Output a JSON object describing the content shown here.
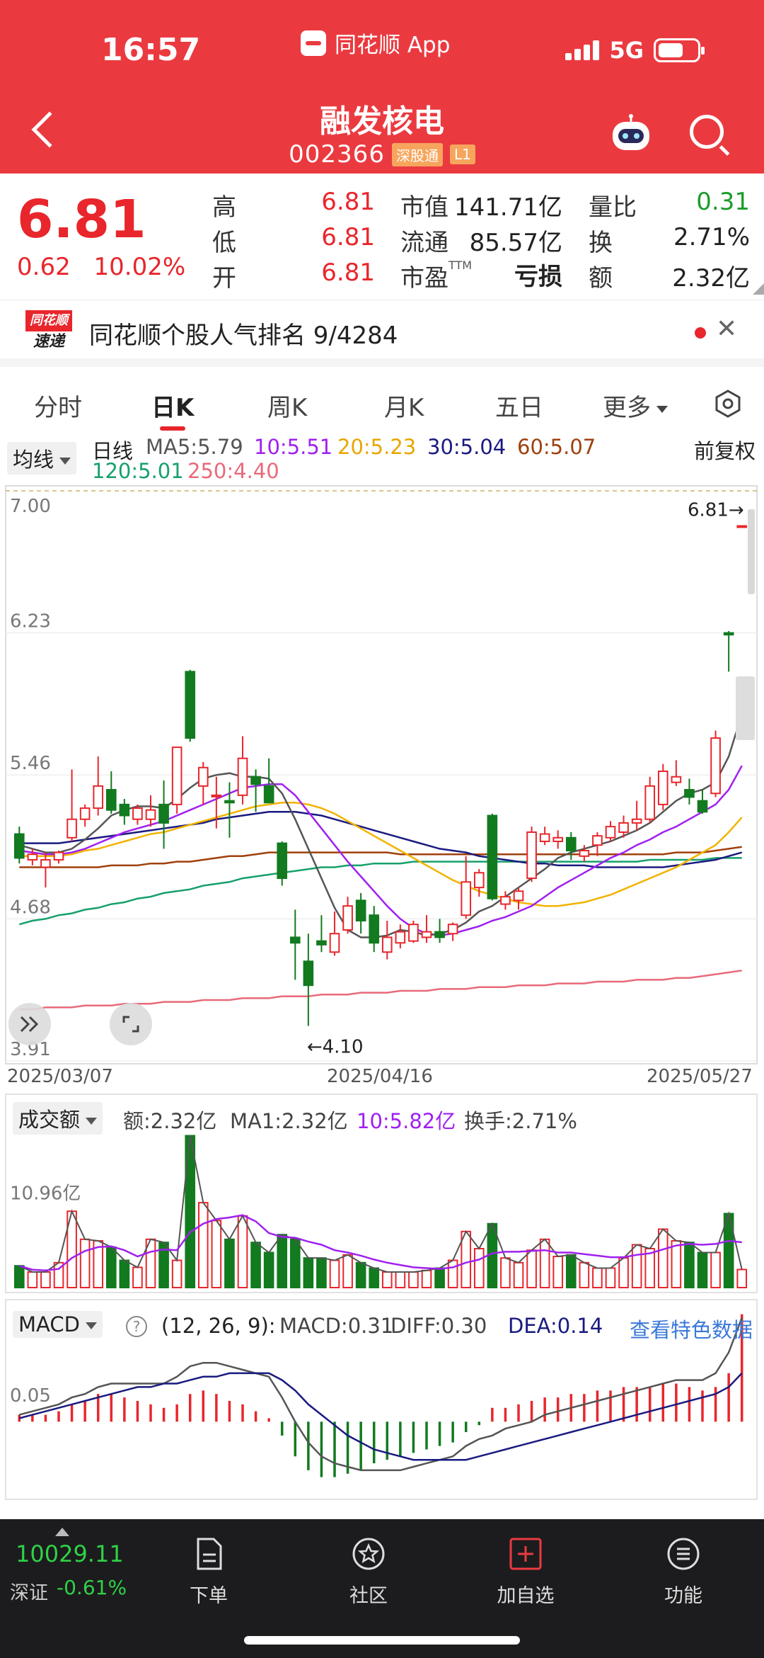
{
  "status": {
    "time": "16:57",
    "app_name": "同花顺 App",
    "network": "5G"
  },
  "header": {
    "stock_name": "融发核电",
    "stock_code": "002366",
    "tag_connect": "深股通",
    "tag_level": "L1"
  },
  "quote": {
    "price": "6.81",
    "change": "0.62",
    "change_pct": "10.02%",
    "high_label": "高",
    "high": "6.81",
    "low_label": "低",
    "low": "6.81",
    "open_label": "开",
    "open": "6.81",
    "mktcap_label": "市值",
    "mktcap": "141.71亿",
    "float_label": "流通",
    "float_cap": "85.57亿",
    "pe_label": "市盈",
    "pe_sup": "TTM",
    "pe": "亏损",
    "vol_ratio_label": "量比",
    "vol_ratio": "0.31",
    "turnover_label": "换",
    "turnover": "2.71%",
    "amount_label": "额",
    "amount": "2.32亿"
  },
  "banner": {
    "logo_top": "同花顺",
    "logo_bottom": "速递",
    "text": "同花顺个股人气排名 9/4284"
  },
  "tabs": [
    "分时",
    "日K",
    "周K",
    "月K",
    "五日",
    "更多"
  ],
  "legend": {
    "type_dropdown": "均线",
    "period": "日线",
    "ma5": "MA5:5.79",
    "ma10": "10:5.51",
    "ma20": "20:5.23",
    "ma30": "30:5.04",
    "ma60": "60:5.07",
    "ma120": "120:5.01",
    "ma250": "250:4.40",
    "adjust": "前复权"
  },
  "colors": {
    "up": "#e8262c",
    "down": "#127a1f",
    "ma5": "#555555",
    "ma10": "#a020f0",
    "ma20": "#f2b300",
    "ma30": "#1a1a80",
    "ma60": "#a0400c",
    "ma120": "#17a06c",
    "ma250": "#e86a7a"
  },
  "chart_data": [
    {
      "type": "candlestick",
      "y_ticks": [
        "7.00",
        "6.23",
        "5.46",
        "4.68",
        "3.91"
      ],
      "ylim": [
        3.91,
        7.0
      ],
      "x_labels": [
        "2025/03/07",
        "2025/04/16",
        "2025/05/27"
      ],
      "max_label": "6.81",
      "min_label": "4.10",
      "candles": [
        {
          "o": 5.14,
          "h": 5.18,
          "l": 4.98,
          "c": 5.01
        },
        {
          "o": 5.0,
          "h": 5.06,
          "l": 4.97,
          "c": 5.03
        },
        {
          "o": 4.96,
          "h": 5.04,
          "l": 4.85,
          "c": 5.0
        },
        {
          "o": 5.0,
          "h": 5.05,
          "l": 4.98,
          "c": 5.04
        },
        {
          "o": 5.12,
          "h": 5.49,
          "l": 5.1,
          "c": 5.22
        },
        {
          "o": 5.22,
          "h": 5.3,
          "l": 5.18,
          "c": 5.28
        },
        {
          "o": 5.28,
          "h": 5.56,
          "l": 5.24,
          "c": 5.4
        },
        {
          "o": 5.38,
          "h": 5.48,
          "l": 5.25,
          "c": 5.27
        },
        {
          "o": 5.3,
          "h": 5.33,
          "l": 5.19,
          "c": 5.24
        },
        {
          "o": 5.22,
          "h": 5.3,
          "l": 5.19,
          "c": 5.28
        },
        {
          "o": 5.22,
          "h": 5.35,
          "l": 5.18,
          "c": 5.27
        },
        {
          "o": 5.3,
          "h": 5.43,
          "l": 5.06,
          "c": 5.2
        },
        {
          "o": 5.3,
          "h": 5.6,
          "l": 5.25,
          "c": 5.61
        },
        {
          "o": 6.02,
          "h": 6.03,
          "l": 5.64,
          "c": 5.66
        },
        {
          "o": 5.4,
          "h": 5.53,
          "l": 5.3,
          "c": 5.5
        },
        {
          "o": 5.35,
          "h": 5.45,
          "l": 5.17,
          "c": 5.35
        },
        {
          "o": 5.32,
          "h": 5.42,
          "l": 5.12,
          "c": 5.31
        },
        {
          "o": 5.35,
          "h": 5.67,
          "l": 5.3,
          "c": 5.55
        },
        {
          "o": 5.45,
          "h": 5.49,
          "l": 5.26,
          "c": 5.41
        },
        {
          "o": 5.4,
          "h": 5.55,
          "l": 5.33,
          "c": 5.31
        },
        {
          "o": 5.09,
          "h": 5.1,
          "l": 4.86,
          "c": 4.9
        },
        {
          "o": 4.58,
          "h": 4.73,
          "l": 4.35,
          "c": 4.55
        },
        {
          "o": 4.45,
          "h": 4.6,
          "l": 4.1,
          "c": 4.32
        },
        {
          "o": 4.56,
          "h": 4.7,
          "l": 4.5,
          "c": 4.54
        },
        {
          "o": 4.5,
          "h": 4.72,
          "l": 4.48,
          "c": 4.6
        },
        {
          "o": 4.62,
          "h": 4.8,
          "l": 4.6,
          "c": 4.75
        },
        {
          "o": 4.78,
          "h": 4.82,
          "l": 4.6,
          "c": 4.67
        },
        {
          "o": 4.7,
          "h": 4.75,
          "l": 4.5,
          "c": 4.55
        },
        {
          "o": 4.5,
          "h": 4.67,
          "l": 4.46,
          "c": 4.58
        },
        {
          "o": 4.55,
          "h": 4.65,
          "l": 4.52,
          "c": 4.61
        },
        {
          "o": 4.56,
          "h": 4.67,
          "l": 4.55,
          "c": 4.65
        },
        {
          "o": 4.58,
          "h": 4.7,
          "l": 4.55,
          "c": 4.61
        },
        {
          "o": 4.61,
          "h": 4.68,
          "l": 4.55,
          "c": 4.58
        },
        {
          "o": 4.6,
          "h": 4.66,
          "l": 4.56,
          "c": 4.65
        },
        {
          "o": 4.7,
          "h": 5.02,
          "l": 4.68,
          "c": 4.88
        },
        {
          "o": 4.85,
          "h": 4.95,
          "l": 4.8,
          "c": 4.93
        },
        {
          "o": 5.24,
          "h": 5.25,
          "l": 4.78,
          "c": 4.79
        },
        {
          "o": 4.76,
          "h": 4.83,
          "l": 4.73,
          "c": 4.8
        },
        {
          "o": 4.78,
          "h": 4.85,
          "l": 4.73,
          "c": 4.83
        },
        {
          "o": 4.9,
          "h": 5.18,
          "l": 4.88,
          "c": 5.15
        },
        {
          "o": 5.1,
          "h": 5.18,
          "l": 5.08,
          "c": 5.14
        },
        {
          "o": 5.1,
          "h": 5.16,
          "l": 5.06,
          "c": 5.12
        },
        {
          "o": 5.12,
          "h": 5.15,
          "l": 5.0,
          "c": 5.05
        },
        {
          "o": 5.02,
          "h": 5.08,
          "l": 4.99,
          "c": 5.05
        },
        {
          "o": 5.08,
          "h": 5.15,
          "l": 5.02,
          "c": 5.13
        },
        {
          "o": 5.12,
          "h": 5.21,
          "l": 5.1,
          "c": 5.18
        },
        {
          "o": 5.15,
          "h": 5.24,
          "l": 5.12,
          "c": 5.2
        },
        {
          "o": 5.2,
          "h": 5.32,
          "l": 5.16,
          "c": 5.22
        },
        {
          "o": 5.22,
          "h": 5.45,
          "l": 5.2,
          "c": 5.4
        },
        {
          "o": 5.3,
          "h": 5.52,
          "l": 5.27,
          "c": 5.48
        },
        {
          "o": 5.42,
          "h": 5.54,
          "l": 5.4,
          "c": 5.45
        },
        {
          "o": 5.38,
          "h": 5.44,
          "l": 5.3,
          "c": 5.34
        },
        {
          "o": 5.32,
          "h": 5.38,
          "l": 5.25,
          "c": 5.26
        },
        {
          "o": 5.36,
          "h": 5.7,
          "l": 5.34,
          "c": 5.66
        },
        {
          "o": 6.23,
          "h": 6.24,
          "l": 6.02,
          "c": 6.22
        },
        {
          "o": 6.81,
          "h": 6.81,
          "l": 6.81,
          "c": 6.81
        }
      ],
      "ma_series": {
        "ma5": [
          5.08,
          5.06,
          5.04,
          5.04,
          5.06,
          5.11,
          5.17,
          5.24,
          5.27,
          5.29,
          5.29,
          5.28,
          5.33,
          5.39,
          5.44,
          5.46,
          5.47,
          5.45,
          5.45,
          5.44,
          5.36,
          5.22,
          5.06,
          4.9,
          4.74,
          4.62,
          4.58,
          4.58,
          4.59,
          4.62,
          4.61,
          4.59,
          4.6,
          4.62,
          4.66,
          4.72,
          4.75,
          4.8,
          4.85,
          4.9,
          4.95,
          5.01,
          5.04,
          5.06,
          5.08,
          5.1,
          5.13,
          5.16,
          5.2,
          5.26,
          5.32,
          5.36,
          5.38,
          5.42,
          5.56,
          5.79
        ],
        "ma10": [
          5.05,
          5.04,
          5.03,
          5.03,
          5.04,
          5.06,
          5.09,
          5.12,
          5.15,
          5.17,
          5.19,
          5.21,
          5.24,
          5.27,
          5.3,
          5.33,
          5.36,
          5.39,
          5.4,
          5.41,
          5.41,
          5.35,
          5.26,
          5.17,
          5.08,
          4.99,
          4.91,
          4.83,
          4.75,
          4.68,
          4.63,
          4.6,
          4.59,
          4.6,
          4.62,
          4.64,
          4.67,
          4.69,
          4.72,
          4.75,
          4.8,
          4.85,
          4.89,
          4.93,
          4.97,
          5.01,
          5.04,
          5.08,
          5.11,
          5.15,
          5.18,
          5.22,
          5.26,
          5.3,
          5.38,
          5.51
        ],
        "ma20": [
          5.02,
          5.02,
          5.02,
          5.02,
          5.03,
          5.05,
          5.06,
          5.08,
          5.1,
          5.12,
          5.14,
          5.15,
          5.17,
          5.19,
          5.21,
          5.23,
          5.25,
          5.27,
          5.29,
          5.3,
          5.31,
          5.31,
          5.3,
          5.28,
          5.25,
          5.21,
          5.17,
          5.13,
          5.09,
          5.05,
          5.01,
          4.97,
          4.93,
          4.89,
          4.86,
          4.83,
          4.81,
          4.79,
          4.77,
          4.76,
          4.75,
          4.75,
          4.76,
          4.77,
          4.79,
          4.81,
          4.84,
          4.87,
          4.9,
          4.93,
          4.96,
          5.0,
          5.04,
          5.08,
          5.15,
          5.23
        ],
        "ma30": [
          5.09,
          5.09,
          5.09,
          5.09,
          5.1,
          5.11,
          5.12,
          5.13,
          5.14,
          5.15,
          5.16,
          5.17,
          5.18,
          5.19,
          5.2,
          5.22,
          5.23,
          5.24,
          5.25,
          5.26,
          5.26,
          5.26,
          5.25,
          5.24,
          5.22,
          5.2,
          5.18,
          5.16,
          5.14,
          5.12,
          5.1,
          5.08,
          5.06,
          5.05,
          5.04,
          5.02,
          5.01,
          5.0,
          4.99,
          4.98,
          4.98,
          4.97,
          4.97,
          4.97,
          4.96,
          4.96,
          4.96,
          4.96,
          4.96,
          4.96,
          4.97,
          4.98,
          4.99,
          5.0,
          5.02,
          5.04
        ],
        "ma60": [
          4.96,
          4.96,
          4.96,
          4.96,
          4.96,
          4.96,
          4.96,
          4.97,
          4.97,
          4.97,
          4.98,
          4.98,
          4.99,
          4.99,
          5.0,
          5.01,
          5.02,
          5.02,
          5.03,
          5.04,
          5.04,
          5.04,
          5.04,
          5.04,
          5.04,
          5.04,
          5.04,
          5.04,
          5.04,
          5.03,
          5.03,
          5.03,
          5.03,
          5.03,
          5.03,
          5.03,
          5.03,
          5.03,
          5.03,
          5.03,
          5.03,
          5.03,
          5.03,
          5.03,
          5.03,
          5.03,
          5.03,
          5.03,
          5.03,
          5.03,
          5.04,
          5.04,
          5.04,
          5.05,
          5.06,
          5.07
        ],
        "ma120": [
          4.65,
          4.67,
          4.68,
          4.7,
          4.71,
          4.73,
          4.74,
          4.76,
          4.77,
          4.79,
          4.8,
          4.82,
          4.83,
          4.84,
          4.86,
          4.87,
          4.88,
          4.9,
          4.91,
          4.92,
          4.93,
          4.94,
          4.95,
          4.96,
          4.96,
          4.97,
          4.97,
          4.98,
          4.98,
          4.98,
          4.99,
          4.99,
          4.99,
          4.99,
          4.99,
          4.99,
          4.99,
          4.99,
          4.99,
          4.99,
          4.99,
          4.99,
          4.99,
          4.99,
          4.99,
          4.99,
          4.99,
          4.99,
          5.0,
          5.0,
          5.0,
          5.0,
          5.0,
          5.01,
          5.01,
          5.01
        ],
        "ma250": [
          4.19,
          4.19,
          4.2,
          4.2,
          4.2,
          4.21,
          4.21,
          4.21,
          4.22,
          4.22,
          4.22,
          4.23,
          4.23,
          4.23,
          4.24,
          4.24,
          4.24,
          4.25,
          4.25,
          4.25,
          4.26,
          4.26,
          4.26,
          4.27,
          4.27,
          4.27,
          4.28,
          4.28,
          4.28,
          4.29,
          4.29,
          4.29,
          4.3,
          4.3,
          4.3,
          4.31,
          4.31,
          4.31,
          4.32,
          4.32,
          4.32,
          4.33,
          4.33,
          4.33,
          4.34,
          4.34,
          4.34,
          4.35,
          4.35,
          4.35,
          4.36,
          4.36,
          4.37,
          4.38,
          4.39,
          4.4
        ]
      }
    },
    {
      "type": "bar",
      "title": "成交额",
      "y_tick": "10.96亿",
      "ylim": [
        0,
        20
      ],
      "values": [
        2.8,
        2.0,
        2.0,
        3.2,
        9.8,
        6.2,
        6.0,
        5.2,
        3.5,
        2.6,
        6.2,
        5.8,
        3.5,
        19.5,
        10.9,
        8.6,
        6.2,
        9.2,
        5.8,
        4.5,
        6.8,
        6.2,
        3.8,
        3.8,
        3.5,
        4.2,
        3.2,
        2.5,
        2.0,
        2.0,
        2.0,
        2.2,
        2.5,
        3.5,
        7.2,
        5.0,
        8.2,
        3.8,
        3.2,
        4.8,
        6.2,
        4.0,
        4.2,
        3.2,
        2.5,
        2.5,
        3.8,
        5.5,
        5.0,
        7.5,
        6.0,
        5.8,
        4.5,
        4.5,
        9.5,
        2.32
      ],
      "ma1": [
        2.8,
        2.3,
        2.2,
        2.4,
        3.8,
        4.7,
        5.2,
        5.3,
        4.8,
        4.0,
        4.6,
        4.9,
        4.8,
        7.1,
        8.2,
        8.8,
        9.0,
        9.3,
        8.5,
        7.0,
        6.5,
        6.4,
        5.9,
        5.5,
        4.8,
        4.5,
        4.1,
        3.6,
        3.2,
        2.9,
        2.6,
        2.5,
        2.4,
        2.6,
        3.2,
        3.6,
        4.4,
        4.6,
        4.6,
        4.7,
        4.8,
        4.5,
        4.5,
        4.3,
        4.1,
        3.9,
        3.9,
        4.2,
        4.4,
        4.9,
        5.4,
        5.6,
        5.5,
        5.6,
        6.0,
        5.82
      ],
      "header": {
        "amount": "额:2.32亿",
        "ma1": "MA1:2.32亿",
        "ma10": "10:5.82亿",
        "turnover": "换手:2.71%"
      }
    },
    {
      "type": "macd",
      "params": "(12, 26, 9):",
      "macd": "MACD:0.31",
      "diff": "DIFF:0.30",
      "dea": "DEA:0.14",
      "y_tick": "0.05",
      "ylim": [
        -0.22,
        0.34
      ],
      "hist": [
        0.02,
        0.02,
        0.02,
        0.03,
        0.05,
        0.06,
        0.08,
        0.08,
        0.07,
        0.06,
        0.05,
        0.04,
        0.05,
        0.08,
        0.09,
        0.08,
        0.06,
        0.05,
        0.03,
        0.01,
        -0.04,
        -0.1,
        -0.14,
        -0.16,
        -0.16,
        -0.15,
        -0.14,
        -0.12,
        -0.11,
        -0.1,
        -0.09,
        -0.08,
        -0.07,
        -0.06,
        -0.03,
        -0.01,
        0.04,
        0.04,
        0.05,
        0.06,
        0.07,
        0.07,
        0.08,
        0.08,
        0.09,
        0.09,
        0.1,
        0.1,
        0.1,
        0.11,
        0.11,
        0.1,
        0.09,
        0.1,
        0.14,
        0.31
      ],
      "diff_series": [
        0.02,
        0.03,
        0.04,
        0.05,
        0.07,
        0.08,
        0.1,
        0.11,
        0.11,
        0.11,
        0.11,
        0.11,
        0.13,
        0.16,
        0.17,
        0.17,
        0.16,
        0.15,
        0.14,
        0.13,
        0.07,
        0.0,
        -0.06,
        -0.1,
        -0.12,
        -0.13,
        -0.14,
        -0.14,
        -0.14,
        -0.14,
        -0.13,
        -0.12,
        -0.11,
        -0.1,
        -0.07,
        -0.05,
        -0.04,
        -0.02,
        -0.01,
        0.0,
        0.02,
        0.03,
        0.04,
        0.05,
        0.06,
        0.07,
        0.08,
        0.09,
        0.1,
        0.11,
        0.12,
        0.12,
        0.12,
        0.14,
        0.2,
        0.3
      ],
      "dea_series": [
        0.01,
        0.02,
        0.03,
        0.04,
        0.05,
        0.06,
        0.07,
        0.08,
        0.09,
        0.1,
        0.1,
        0.11,
        0.11,
        0.12,
        0.13,
        0.13,
        0.14,
        0.14,
        0.14,
        0.14,
        0.12,
        0.09,
        0.05,
        0.02,
        -0.01,
        -0.04,
        -0.06,
        -0.08,
        -0.09,
        -0.1,
        -0.11,
        -0.11,
        -0.11,
        -0.11,
        -0.11,
        -0.1,
        -0.09,
        -0.08,
        -0.07,
        -0.06,
        -0.05,
        -0.04,
        -0.03,
        -0.02,
        -0.01,
        0.0,
        0.01,
        0.02,
        0.03,
        0.04,
        0.05,
        0.06,
        0.07,
        0.08,
        0.1,
        0.14
      ],
      "link": "查看特色数据"
    }
  ],
  "bottom": {
    "index_value": "10029.11",
    "index_name": "深证",
    "index_change": "-0.61%",
    "nav": [
      "下单",
      "社区",
      "加自选",
      "功能"
    ]
  }
}
